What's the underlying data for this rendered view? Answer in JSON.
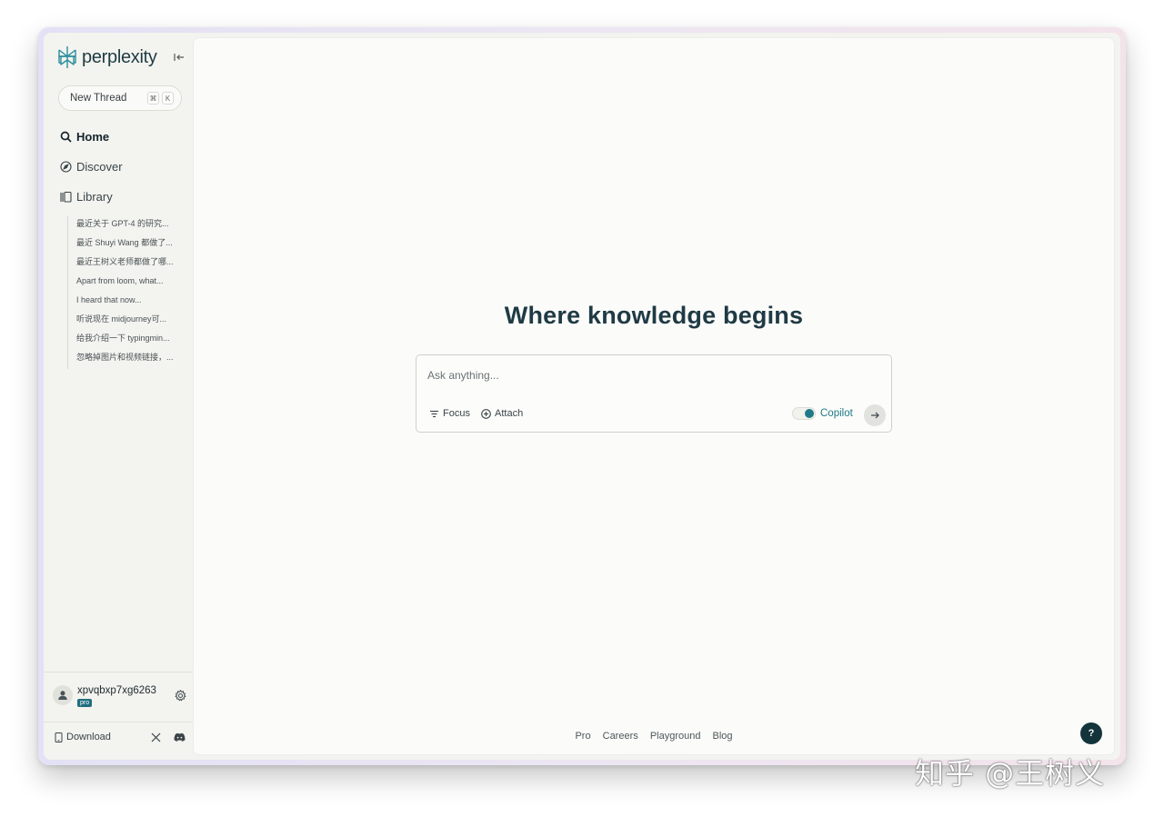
{
  "app": {
    "logo_text": "perplexity"
  },
  "sidebar": {
    "new_thread": {
      "label": "New Thread",
      "shortcut_keys": [
        "⌘",
        "K"
      ]
    },
    "nav": [
      {
        "label": "Home",
        "icon": "search-icon",
        "active": true
      },
      {
        "label": "Discover",
        "icon": "compass-icon",
        "active": false
      },
      {
        "label": "Library",
        "icon": "library-icon",
        "active": false
      }
    ],
    "library_items": [
      "最近关于 GPT-4 的研究...",
      "最近 Shuyi Wang 都做了...",
      "最近王树义老师都做了哪...",
      "Apart from loom, what...",
      "I heard that now...",
      "听说现在 midjourney可...",
      "给我介绍一下 typingmin...",
      "忽略掉图片和视频链接，..."
    ],
    "user": {
      "name": "xpvqbxp7xg6263",
      "badge": "pro"
    },
    "download_label": "Download"
  },
  "main": {
    "headline": "Where knowledge begins",
    "ask": {
      "placeholder": "Ask anything...",
      "focus_label": "Focus",
      "attach_label": "Attach",
      "copilot_label": "Copilot",
      "copilot_on": true
    },
    "footer_links": [
      "Pro",
      "Careers",
      "Playground",
      "Blog"
    ],
    "help_label": "?"
  },
  "watermark": "知乎 @王树义",
  "colors": {
    "accent": "#1f7a88",
    "sidebar_bg": "#f3f3ef",
    "main_bg": "#fbfbf9",
    "help_bg": "#13343b"
  }
}
